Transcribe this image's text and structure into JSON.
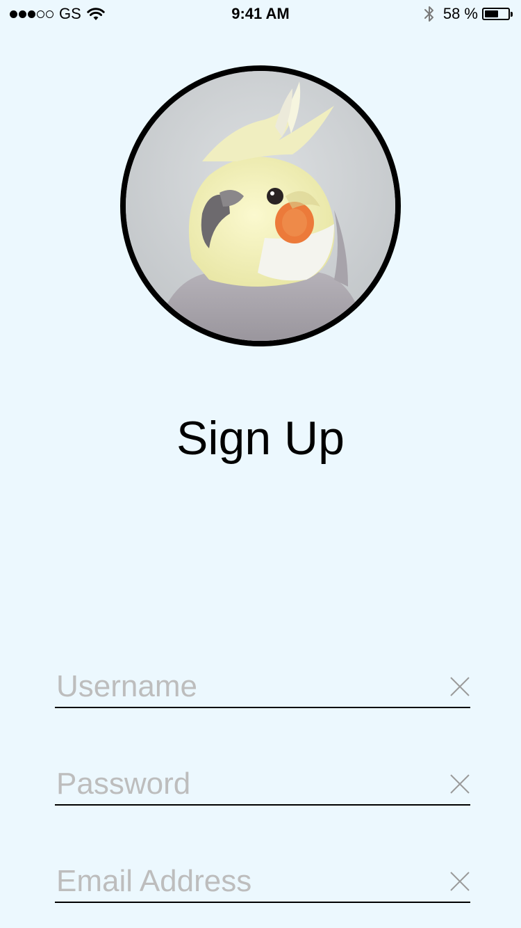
{
  "status_bar": {
    "signal": {
      "filled": 3,
      "total": 5
    },
    "carrier": "GS",
    "time": "9:41 AM",
    "battery_percent_label": "58 %",
    "battery_level": 0.58,
    "icons": [
      "signal-icon",
      "wifi-icon",
      "bluetooth-icon",
      "battery-icon"
    ]
  },
  "avatar": {
    "icon": "cockatiel-avatar-photo"
  },
  "page": {
    "title": "Sign Up",
    "background": "#ecf8fe"
  },
  "form": {
    "username": {
      "placeholder": "Username",
      "value": ""
    },
    "password": {
      "placeholder": "Password",
      "value": ""
    },
    "email": {
      "placeholder": "Email Address",
      "value": ""
    }
  }
}
